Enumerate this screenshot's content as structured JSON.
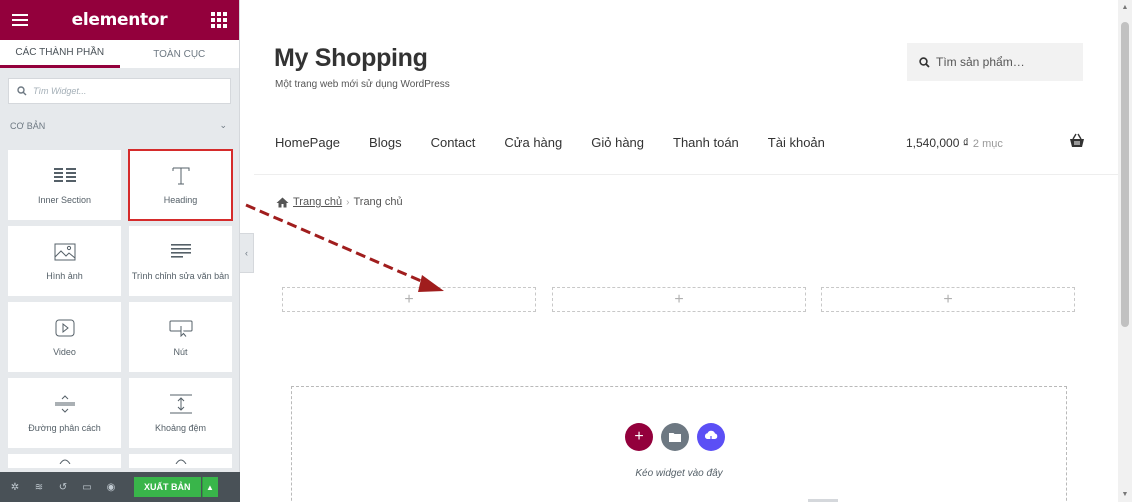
{
  "panel": {
    "brand": "elementor",
    "tabs": [
      {
        "label": "CÁC THÀNH PHẦN",
        "active": true
      },
      {
        "label": "TOÀN CỤC",
        "active": false
      }
    ],
    "search_placeholder": "Tìm Widget...",
    "category": "CƠ BẢN",
    "widgets": [
      {
        "label": "Inner Section",
        "icon": "inner-section-icon"
      },
      {
        "label": "Heading",
        "icon": "heading-icon"
      },
      {
        "label": "Hình ảnh",
        "icon": "image-icon"
      },
      {
        "label": "Trình chỉnh sửa văn bản",
        "icon": "text-editor-icon"
      },
      {
        "label": "Video",
        "icon": "video-icon"
      },
      {
        "label": "Nút",
        "icon": "button-icon"
      },
      {
        "label": "Đường phân cách",
        "icon": "divider-icon"
      },
      {
        "label": "Khoảng đệm",
        "icon": "spacer-icon"
      }
    ],
    "publish_label": "XUẤT BẢN",
    "accent_color": "#93003c",
    "publish_color": "#39b54a",
    "highlight_color": "#d52b2b"
  },
  "site": {
    "title": "My Shopping",
    "description": "Một trang web mới sử dụng WordPress",
    "search_placeholder": "Tìm sản phẩm…",
    "nav": [
      "HomePage",
      "Blogs",
      "Contact",
      "Cửa hàng",
      "Giỏ hàng",
      "Thanh toán",
      "Tài khoản"
    ],
    "cart_total": "1,540,000 ₫",
    "cart_count": "2 mục",
    "breadcrumb": {
      "home": "Trang chủ",
      "current": "Trang chủ"
    },
    "dropzone_text": "Kéo widget vào đây"
  }
}
